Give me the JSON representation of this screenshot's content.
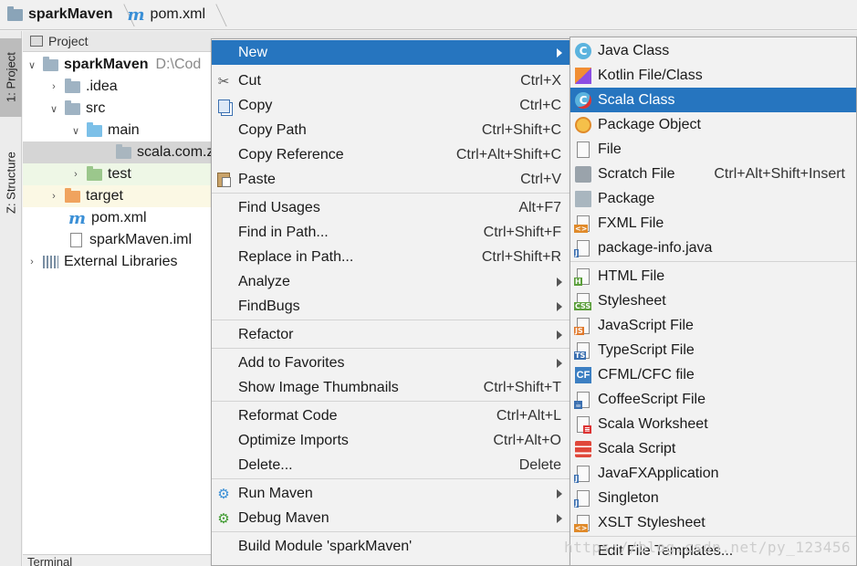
{
  "breadcrumb": {
    "project": "sparkMaven",
    "file": "pom.xml"
  },
  "toolstrip": {
    "project_tab": "1: Project",
    "structure_tab": "Z: Structure"
  },
  "project_panel": {
    "title": "Project",
    "tree": [
      {
        "label": "sparkMaven",
        "hint": "D:\\Cod",
        "icon": "module-folder-icon",
        "expanded": true
      },
      {
        "label": ".idea",
        "icon": "folder-icon",
        "expanded": false
      },
      {
        "label": "src",
        "icon": "folder-icon",
        "expanded": true
      },
      {
        "label": "main",
        "icon": "source-folder-icon",
        "expanded": true
      },
      {
        "label": "scala.com.z",
        "icon": "package-icon"
      },
      {
        "label": "test",
        "icon": "test-folder-icon",
        "expanded": false
      },
      {
        "label": "target",
        "icon": "excluded-folder-icon",
        "expanded": false
      },
      {
        "label": "pom.xml",
        "icon": "maven-icon"
      },
      {
        "label": "sparkMaven.iml",
        "icon": "file-icon"
      },
      {
        "label": "External Libraries",
        "icon": "libraries-icon",
        "expanded": false
      }
    ],
    "terminal": "Terminal"
  },
  "context_menu": {
    "items": [
      {
        "label": "New",
        "shortcut": "",
        "submenu": true
      },
      {
        "label": "Cut",
        "shortcut": "Ctrl+X",
        "icon": "scissors-icon"
      },
      {
        "label": "Copy",
        "shortcut": "Ctrl+C",
        "icon": "copy-icon"
      },
      {
        "label": "Copy Path",
        "shortcut": "Ctrl+Shift+C"
      },
      {
        "label": "Copy Reference",
        "shortcut": "Ctrl+Alt+Shift+C"
      },
      {
        "label": "Paste",
        "shortcut": "Ctrl+V",
        "icon": "paste-icon"
      },
      {
        "label": "Find Usages",
        "shortcut": "Alt+F7"
      },
      {
        "label": "Find in Path...",
        "shortcut": "Ctrl+Shift+F"
      },
      {
        "label": "Replace in Path...",
        "shortcut": "Ctrl+Shift+R"
      },
      {
        "label": "Analyze",
        "shortcut": "",
        "submenu": true
      },
      {
        "label": "FindBugs",
        "shortcut": "",
        "submenu": true
      },
      {
        "label": "Refactor",
        "shortcut": "",
        "submenu": true
      },
      {
        "label": "Add to Favorites",
        "shortcut": "",
        "submenu": true
      },
      {
        "label": "Show Image Thumbnails",
        "shortcut": "Ctrl+Shift+T"
      },
      {
        "label": "Reformat Code",
        "shortcut": "Ctrl+Alt+L"
      },
      {
        "label": "Optimize Imports",
        "shortcut": "Ctrl+Alt+O"
      },
      {
        "label": "Delete...",
        "shortcut": "Delete"
      },
      {
        "label": "Run Maven",
        "shortcut": "",
        "submenu": true,
        "icon": "gear-icon"
      },
      {
        "label": "Debug Maven",
        "shortcut": "",
        "submenu": true,
        "icon": "gear-icon"
      },
      {
        "label": "Build Module 'sparkMaven'",
        "shortcut": ""
      }
    ]
  },
  "new_submenu": {
    "items": [
      {
        "label": "Java Class",
        "shortcut": "",
        "icon": "java-class-icon"
      },
      {
        "label": "Kotlin File/Class",
        "shortcut": "",
        "icon": "kotlin-icon"
      },
      {
        "label": "Scala Class",
        "shortcut": "",
        "icon": "scala-class-icon"
      },
      {
        "label": "Package Object",
        "shortcut": "",
        "icon": "package-object-icon"
      },
      {
        "label": "File",
        "shortcut": "",
        "icon": "file-icon"
      },
      {
        "label": "Scratch File",
        "shortcut": "Ctrl+Alt+Shift+Insert",
        "icon": "scratch-file-icon"
      },
      {
        "label": "Package",
        "shortcut": "",
        "icon": "package-icon"
      },
      {
        "label": "FXML File",
        "shortcut": "",
        "icon": "fxml-icon"
      },
      {
        "label": "package-info.java",
        "shortcut": "",
        "icon": "java-file-icon"
      },
      {
        "label": "HTML File",
        "shortcut": "",
        "icon": "html-icon"
      },
      {
        "label": "Stylesheet",
        "shortcut": "",
        "icon": "css-icon"
      },
      {
        "label": "JavaScript File",
        "shortcut": "",
        "icon": "js-icon"
      },
      {
        "label": "TypeScript File",
        "shortcut": "",
        "icon": "ts-icon"
      },
      {
        "label": "CFML/CFC file",
        "shortcut": "",
        "icon": "cfml-icon"
      },
      {
        "label": "CoffeeScript File",
        "shortcut": "",
        "icon": "coffeescript-icon"
      },
      {
        "label": "Scala Worksheet",
        "shortcut": "",
        "icon": "scala-worksheet-icon"
      },
      {
        "label": "Scala Script",
        "shortcut": "",
        "icon": "scala-script-icon"
      },
      {
        "label": "JavaFXApplication",
        "shortcut": "",
        "icon": "java-file-icon"
      },
      {
        "label": "Singleton",
        "shortcut": "",
        "icon": "java-file-icon"
      },
      {
        "label": "XSLT Stylesheet",
        "shortcut": "",
        "icon": "xslt-icon"
      },
      {
        "label": "Edit File Templates...",
        "shortcut": ""
      }
    ]
  },
  "watermark": "https://blog.csdn.net/py_123456",
  "colors": {
    "highlight": "#2675bf",
    "menu_bg": "#f2f2f2"
  }
}
